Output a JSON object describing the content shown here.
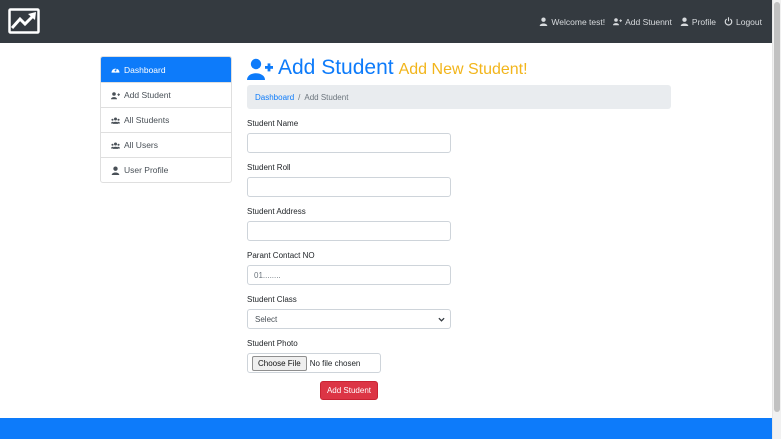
{
  "navbar": {
    "brand_icon": "chart-line-icon",
    "links": [
      {
        "label": "Welcome test!",
        "icon": "user-icon"
      },
      {
        "label": "Add Stuennt",
        "icon": "user-plus-icon"
      },
      {
        "label": "Profile",
        "icon": "user-icon"
      },
      {
        "label": "Logout",
        "icon": "power-icon"
      }
    ]
  },
  "sidebar": {
    "items": [
      {
        "label": "Dashboard",
        "icon": "dashboard-icon",
        "active": true
      },
      {
        "label": "Add Student",
        "icon": "user-plus-icon"
      },
      {
        "label": "All Students",
        "icon": "users-icon"
      },
      {
        "label": "All Users",
        "icon": "users-icon"
      },
      {
        "label": "User Profile",
        "icon": "user-icon"
      }
    ]
  },
  "page": {
    "title": "Add Student",
    "subtitle": "Add New Student!",
    "title_icon": "user-plus-icon"
  },
  "breadcrumb": {
    "home": "Dashboard",
    "separator": "/",
    "current": "Add Student"
  },
  "form": {
    "student_name": {
      "label": "Student Name",
      "value": ""
    },
    "student_roll": {
      "label": "Student Roll",
      "value": ""
    },
    "student_address": {
      "label": "Student Address",
      "value": ""
    },
    "parent_contact": {
      "label": "Parant Contact NO",
      "placeholder": "01........"
    },
    "student_class": {
      "label": "Student Class",
      "selected": "Select"
    },
    "student_photo": {
      "label": "Student Photo",
      "button": "Choose File",
      "status": "No file chosen"
    },
    "submit_label": "Add Student"
  },
  "colors": {
    "primary": "#0d7bfa",
    "accent": "#f2b51b",
    "danger": "#dc3545",
    "navbar": "#343a40"
  }
}
